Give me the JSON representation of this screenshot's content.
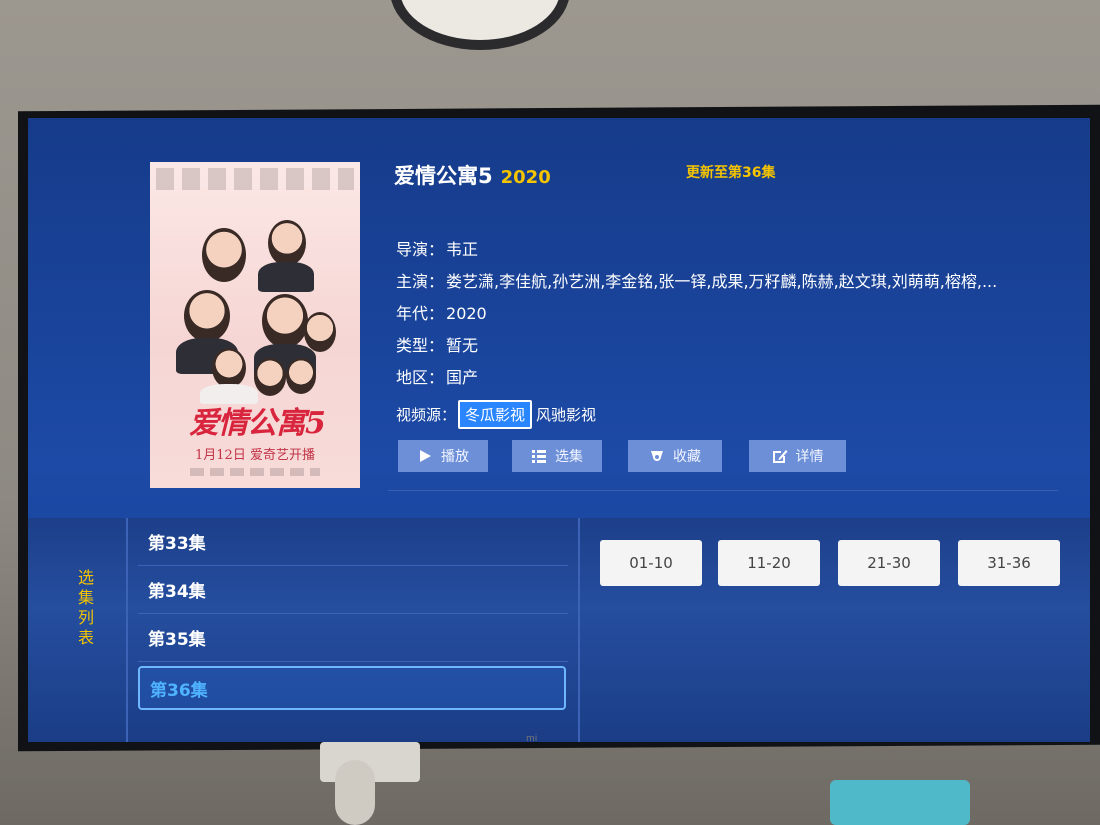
{
  "show": {
    "title": "爱情公寓5",
    "year": "2020",
    "update_status": "更新至第36集",
    "poster_title": "爱情公寓5",
    "poster_date": "1月12日 爱奇艺开播"
  },
  "info": {
    "director_label": "导演：",
    "director": "韦正",
    "cast_label": "主演：",
    "cast": "娄艺潇,李佳航,孙艺洲,李金铭,张一铎,成果,万籽麟,陈赫,赵文琪,刘萌萌,榕榕,...",
    "era_label": "年代：",
    "era": "2020",
    "genre_label": "类型：",
    "genre": "暂无",
    "region_label": "地区：",
    "region": "国产",
    "source_label": "视频源：",
    "sources": [
      "冬瓜影视",
      "风驰影视"
    ]
  },
  "actions": {
    "play": "播放",
    "select": "选集",
    "favorite": "收藏",
    "details": "详情"
  },
  "episodes": {
    "side_label": "选集列表",
    "items": [
      "第33集",
      "第34集",
      "第35集",
      "第36集"
    ],
    "selected": "第36集",
    "ranges": [
      "01-10",
      "11-20",
      "21-30",
      "31-36"
    ]
  },
  "colors": {
    "screen_bg": "#1c4aa6",
    "accent_yellow": "#f5c400",
    "button_bg": "#6c8fd8",
    "source_active": "#2a86ff",
    "selected_text": "#4fb3ff"
  },
  "icons": [
    "play-icon",
    "list-icon",
    "favorite-icon",
    "edit-icon"
  ]
}
